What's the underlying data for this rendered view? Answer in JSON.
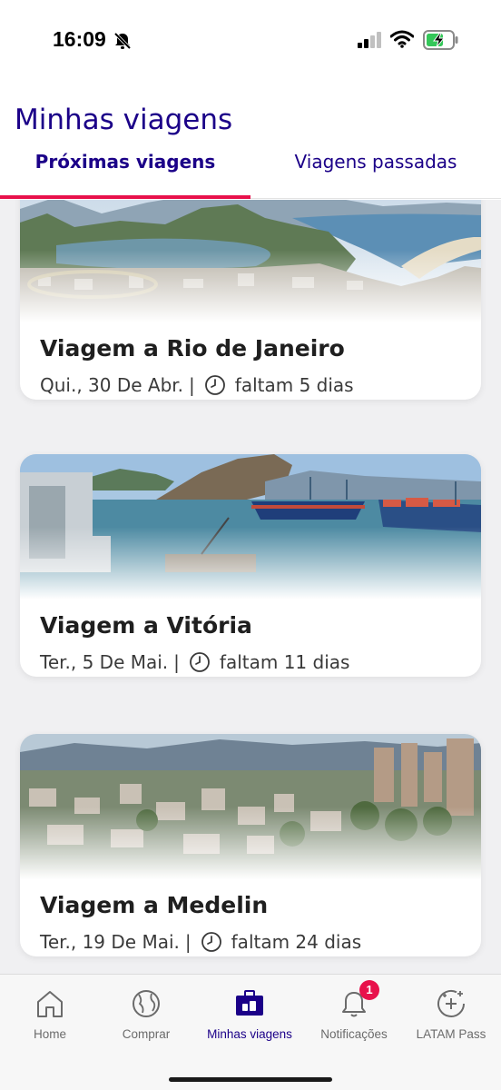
{
  "status_bar": {
    "time": "16:09",
    "icons": [
      "bell-off-icon",
      "signal-icon",
      "wifi-icon",
      "battery-charging-icon"
    ]
  },
  "header": {
    "title": "Minhas viagens",
    "tabs": [
      {
        "label": "Próximas viagens",
        "active": true
      },
      {
        "label": "Viagens passadas",
        "active": false
      }
    ]
  },
  "trips": [
    {
      "title": "Viagem a Rio de Janeiro",
      "date": "Qui., 30 De Abr.",
      "separator": "|",
      "countdown": "faltam 5 dias"
    },
    {
      "title": "Viagem a Vitória",
      "date": "Ter., 5 De Mai.",
      "separator": "|",
      "countdown": "faltam 11 dias"
    },
    {
      "title": "Viagem a Medelin",
      "date": "Ter., 19 De Mai.",
      "separator": "|",
      "countdown": "faltam 24 dias"
    }
  ],
  "bottom_nav": {
    "items": [
      {
        "label": "Home",
        "icon": "home-icon",
        "active": false
      },
      {
        "label": "Comprar",
        "icon": "globe-icon",
        "active": false
      },
      {
        "label": "Minhas viagens",
        "icon": "luggage-icon",
        "active": true
      },
      {
        "label": "Notificações",
        "icon": "bell-icon",
        "active": false,
        "badge": "1"
      },
      {
        "label": "LATAM Pass",
        "icon": "sparkle-circle-icon",
        "active": false
      }
    ]
  },
  "colors": {
    "brand": "#1b0088",
    "accent": "#e8114b",
    "background": "#f0f0f2"
  }
}
